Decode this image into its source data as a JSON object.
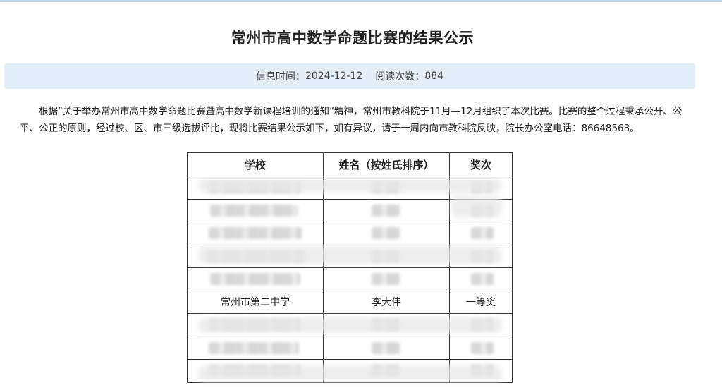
{
  "page": {
    "title": "常州市高中数学命题比赛的结果公示",
    "info": {
      "time_label": "信息时间：",
      "time_value": "2024-12-12",
      "views_label": "阅读次数：",
      "views_value": "884"
    },
    "paragraph": "根据“关于举办常州市高中数学命题比赛暨高中数学新课程培训的通知”精神，常州市教科院于11月—12月组织了本次比赛。比赛的整个过程秉承公开、公平、公正的原则，经过校、区、市三级选拔评比，现将比赛结果公示如下，如有异议，请于一周内向市教科院反映，院长办公室电话：86648563。"
  },
  "table": {
    "headers": [
      "学校",
      "姓名（按姓氏排序）",
      "奖次"
    ],
    "visible_row": {
      "school": "常州市第二中学",
      "name": "李大伟",
      "award": "一等奖"
    }
  }
}
